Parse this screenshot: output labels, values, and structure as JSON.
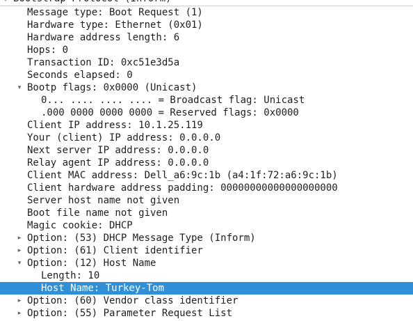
{
  "tree": {
    "rows": [
      {
        "text": "Bootstrap Protocol (Inform)",
        "level": 0,
        "expander": "expanded",
        "selected": false,
        "name": "tree-row-bootstrap-protocol"
      },
      {
        "text": "Message type: Boot Request (1)",
        "level": 1,
        "expander": "none",
        "selected": false,
        "name": "tree-row-message-type"
      },
      {
        "text": "Hardware type: Ethernet (0x01)",
        "level": 1,
        "expander": "none",
        "selected": false,
        "name": "tree-row-hardware-type"
      },
      {
        "text": "Hardware address length: 6",
        "level": 1,
        "expander": "none",
        "selected": false,
        "name": "tree-row-hardware-address-length"
      },
      {
        "text": "Hops: 0",
        "level": 1,
        "expander": "none",
        "selected": false,
        "name": "tree-row-hops"
      },
      {
        "text": "Transaction ID: 0xc51e3d5a",
        "level": 1,
        "expander": "none",
        "selected": false,
        "name": "tree-row-transaction-id"
      },
      {
        "text": "Seconds elapsed: 0",
        "level": 1,
        "expander": "none",
        "selected": false,
        "name": "tree-row-seconds-elapsed"
      },
      {
        "text": "Bootp flags: 0x0000 (Unicast)",
        "level": 1,
        "expander": "expanded",
        "selected": false,
        "name": "tree-row-bootp-flags"
      },
      {
        "text": "0... .... .... .... = Broadcast flag: Unicast",
        "level": 2,
        "expander": "none",
        "selected": false,
        "name": "tree-row-broadcast-flag"
      },
      {
        "text": ".000 0000 0000 0000 = Reserved flags: 0x0000",
        "level": 2,
        "expander": "none",
        "selected": false,
        "name": "tree-row-reserved-flags"
      },
      {
        "text": "Client IP address: 10.1.25.119",
        "level": 1,
        "expander": "none",
        "selected": false,
        "name": "tree-row-client-ip"
      },
      {
        "text": "Your (client) IP address: 0.0.0.0",
        "level": 1,
        "expander": "none",
        "selected": false,
        "name": "tree-row-your-ip"
      },
      {
        "text": "Next server IP address: 0.0.0.0",
        "level": 1,
        "expander": "none",
        "selected": false,
        "name": "tree-row-next-server-ip"
      },
      {
        "text": "Relay agent IP address: 0.0.0.0",
        "level": 1,
        "expander": "none",
        "selected": false,
        "name": "tree-row-relay-agent-ip"
      },
      {
        "text": "Client MAC address: Dell_a6:9c:1b (a4:1f:72:a6:9c:1b)",
        "level": 1,
        "expander": "none",
        "selected": false,
        "name": "tree-row-client-mac"
      },
      {
        "text": "Client hardware address padding: 00000000000000000000",
        "level": 1,
        "expander": "none",
        "selected": false,
        "name": "tree-row-hw-address-padding"
      },
      {
        "text": "Server host name not given",
        "level": 1,
        "expander": "none",
        "selected": false,
        "name": "tree-row-server-host-name"
      },
      {
        "text": "Boot file name not given",
        "level": 1,
        "expander": "none",
        "selected": false,
        "name": "tree-row-boot-file-name"
      },
      {
        "text": "Magic cookie: DHCP",
        "level": 1,
        "expander": "none",
        "selected": false,
        "name": "tree-row-magic-cookie"
      },
      {
        "text": "Option: (53) DHCP Message Type (Inform)",
        "level": 1,
        "expander": "collapsed",
        "selected": false,
        "name": "tree-row-option-53"
      },
      {
        "text": "Option: (61) Client identifier",
        "level": 1,
        "expander": "collapsed",
        "selected": false,
        "name": "tree-row-option-61"
      },
      {
        "text": "Option: (12) Host Name",
        "level": 1,
        "expander": "expanded",
        "selected": false,
        "name": "tree-row-option-12"
      },
      {
        "text": "Length: 10",
        "level": 2,
        "expander": "none",
        "selected": false,
        "name": "tree-row-host-name-length"
      },
      {
        "text": "Host Name: Turkey-Tom",
        "level": 2,
        "expander": "none",
        "selected": true,
        "name": "tree-row-host-name"
      },
      {
        "text": "Option: (60) Vendor class identifier",
        "level": 1,
        "expander": "collapsed",
        "selected": false,
        "name": "tree-row-option-60"
      },
      {
        "text": "Option: (55) Parameter Request List",
        "level": 1,
        "expander": "collapsed",
        "selected": false,
        "name": "tree-row-option-55"
      }
    ]
  },
  "icons": {
    "expanded": "▾",
    "collapsed": "▸"
  },
  "colors": {
    "selection_background": "#2f8fd8",
    "selection_text": "#ffffff",
    "text": "#1e1e1e",
    "expander": "#606060"
  }
}
